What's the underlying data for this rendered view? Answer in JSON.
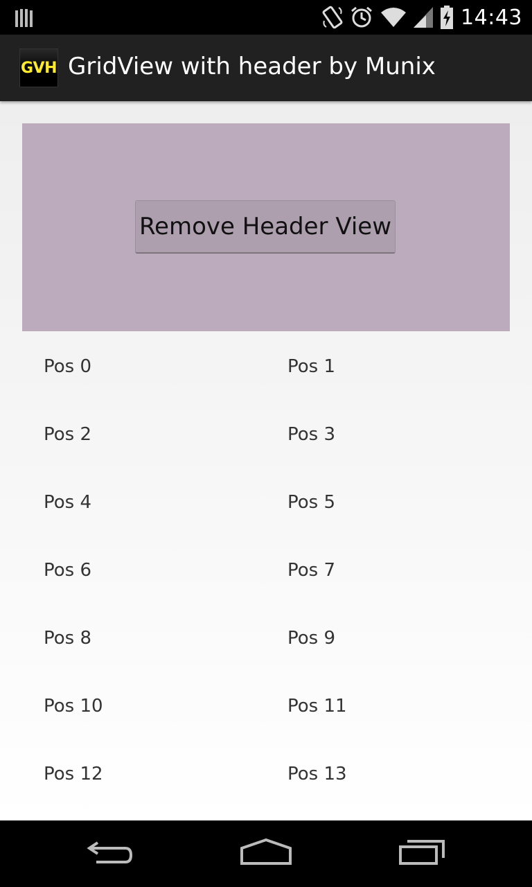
{
  "status_bar": {
    "time": "14:43",
    "icons": [
      "notification-bars-icon",
      "screen-rotation-icon",
      "alarm-clock-icon",
      "wifi-icon",
      "signal-icon",
      "battery-charging-icon"
    ]
  },
  "action_bar": {
    "app_icon_text": "GVH",
    "title": "GridView with header by Munix"
  },
  "header_view": {
    "background": "#bcabbd",
    "button_label": "Remove Header View"
  },
  "grid": {
    "items": [
      "Pos 0",
      "Pos 1",
      "Pos 2",
      "Pos 3",
      "Pos 4",
      "Pos 5",
      "Pos 6",
      "Pos 7",
      "Pos 8",
      "Pos 9",
      "Pos 10",
      "Pos 11",
      "Pos 12",
      "Pos 13"
    ]
  },
  "nav_bar": {
    "icons": [
      "back-icon",
      "home-icon",
      "recent-apps-icon"
    ]
  }
}
